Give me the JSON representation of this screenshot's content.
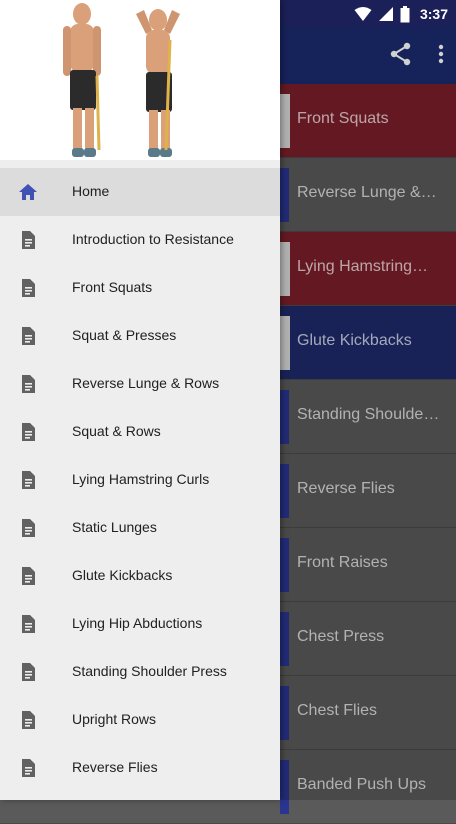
{
  "status_bar": {
    "time": "3:37",
    "icons": [
      "wifi-icon",
      "signal-icon",
      "battery-icon"
    ]
  },
  "app_bar": {
    "actions": [
      "share-icon",
      "more-vert-icon"
    ]
  },
  "drawer": {
    "header_image": "resistance-band-exercise-illustration",
    "items": [
      {
        "label": "Home",
        "icon": "home-icon",
        "active": true
      },
      {
        "label": "Introduction to Resistance",
        "icon": "document-icon"
      },
      {
        "label": "Front Squats",
        "icon": "document-icon"
      },
      {
        "label": "Squat & Presses",
        "icon": "document-icon"
      },
      {
        "label": "Reverse Lunge & Rows",
        "icon": "document-icon"
      },
      {
        "label": "Squat & Rows",
        "icon": "document-icon"
      },
      {
        "label": "Lying Hamstring Curls",
        "icon": "document-icon"
      },
      {
        "label": "Static Lunges",
        "icon": "document-icon"
      },
      {
        "label": "Glute Kickbacks",
        "icon": "document-icon"
      },
      {
        "label": "Lying Hip Abductions",
        "icon": "document-icon"
      },
      {
        "label": "Standing Shoulder Press",
        "icon": "document-icon"
      },
      {
        "label": "Upright Rows",
        "icon": "document-icon"
      },
      {
        "label": "Reverse Flies",
        "icon": "document-icon"
      }
    ]
  },
  "main_list": {
    "items": [
      {
        "label": "Front Squats",
        "style": "red"
      },
      {
        "label": "Reverse Lunge &…",
        "style": "plain"
      },
      {
        "label": "Lying Hamstring…",
        "style": "red"
      },
      {
        "label": "Glute Kickbacks",
        "style": "blue"
      },
      {
        "label": "Standing Shoulde…",
        "style": "plain"
      },
      {
        "label": "Reverse Flies",
        "style": "plain"
      },
      {
        "label": "Front Raises",
        "style": "plain"
      },
      {
        "label": "Chest Press",
        "style": "plain"
      },
      {
        "label": "Chest Flies",
        "style": "plain"
      },
      {
        "label": "Banded Push Ups",
        "style": "plain"
      }
    ]
  },
  "colors": {
    "active_icon": "#3f51b5",
    "icon_gray": "#616161",
    "app_bar": "#1b2a6e",
    "highlight_red": "#7a1f2a",
    "highlight_blue": "#1f2a6a"
  }
}
